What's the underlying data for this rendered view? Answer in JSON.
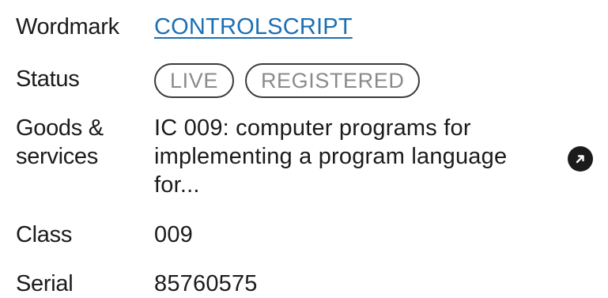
{
  "wordmark": {
    "label": "Wordmark",
    "value": "CONTROLSCRIPT"
  },
  "status": {
    "label": "Status",
    "badges": [
      "LIVE",
      "REGISTERED"
    ]
  },
  "goods_services": {
    "label_line1": "Goods &",
    "label_line2": "services",
    "text": "IC 009: computer programs for implementing a program language for...",
    "open_icon": "arrow-up-right-icon"
  },
  "class": {
    "label": "Class",
    "value": "009"
  },
  "serial": {
    "label": "Serial",
    "value": "85760575"
  }
}
